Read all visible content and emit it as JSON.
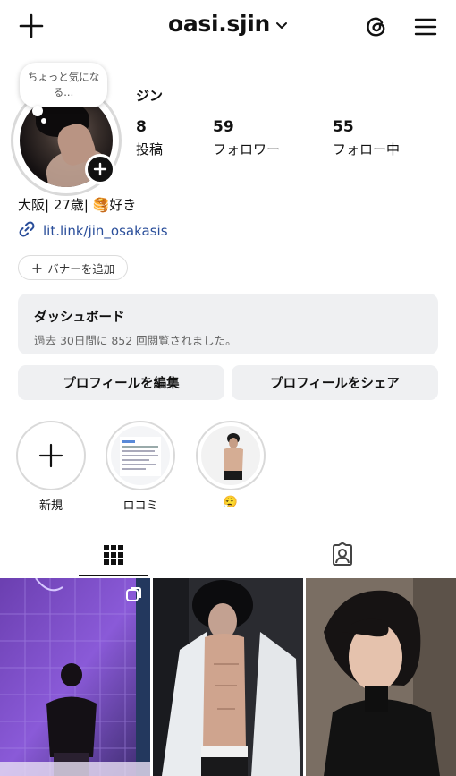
{
  "header": {
    "username": "oasi.sjin",
    "icons": {
      "create": "plus-icon",
      "switch": "chevron-down-icon",
      "threads": "threads-icon",
      "menu": "hamburger-menu-icon"
    }
  },
  "profile": {
    "note": "ちょっと気になる...",
    "display_name": "ジン",
    "stats": [
      {
        "value": "8",
        "label": "投稿"
      },
      {
        "value": "59",
        "label": "フォロワー"
      },
      {
        "value": "55",
        "label": "フォロー中"
      }
    ],
    "bio": "大阪| 27歳| 🥞好き",
    "link": "lit.link/jin_osakasis",
    "add_banner": "バナーを追加"
  },
  "dashboard": {
    "title": "ダッシュボード",
    "subtitle": "過去 30日間に 852 回閲覧されました。"
  },
  "actions": {
    "edit_profile": "プロフィールを編集",
    "share_profile": "プロフィールをシェア"
  },
  "highlights": [
    {
      "label": "新規"
    },
    {
      "label": "ロコミ"
    },
    {
      "label": "😮‍💨"
    }
  ],
  "tabs": {
    "grid": "grid-icon",
    "tagged": "tagged-icon"
  },
  "colors": {
    "link": "#2a4e9a",
    "button_bg": "#eff0f2",
    "accent_text": "#111111"
  }
}
